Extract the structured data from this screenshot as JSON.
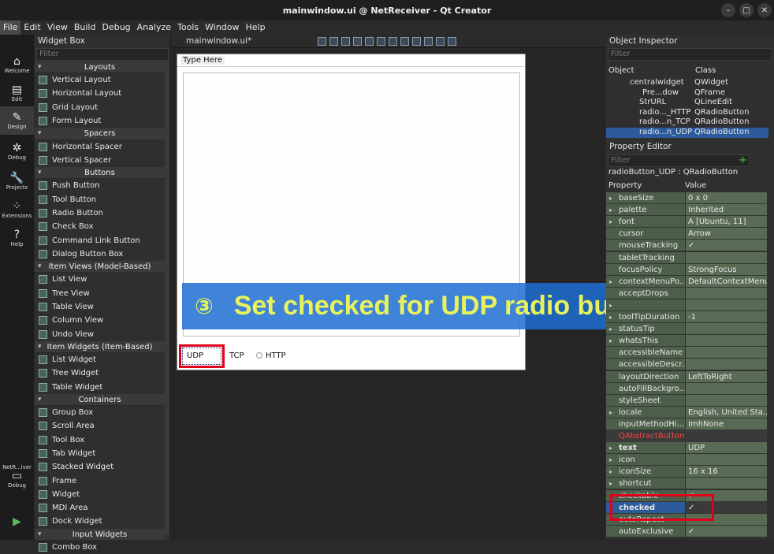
{
  "window": {
    "title": "mainwindow.ui @ NetReceiver - Qt Creator",
    "minimize": "–",
    "maximize": "□",
    "close": "✕"
  },
  "menu": [
    "File",
    "Edit",
    "View",
    "Build",
    "Debug",
    "Analyze",
    "Tools",
    "Window",
    "Help"
  ],
  "modes": [
    {
      "label": "Welcome",
      "icon": "⌂"
    },
    {
      "label": "Edit",
      "icon": "▤"
    },
    {
      "label": "Design",
      "icon": "✎"
    },
    {
      "label": "Debug",
      "icon": "✲"
    },
    {
      "label": "Projects",
      "icon": "🔧"
    },
    {
      "label": "Extensions",
      "icon": "⁘"
    },
    {
      "label": "Help",
      "icon": "?"
    }
  ],
  "kit": {
    "label": "NetR...iver",
    "sub": "Debug",
    "run": "▶"
  },
  "widget_box": {
    "title": "Widget Box",
    "filter_placeholder": "Filter",
    "groups": [
      {
        "name": "Layouts",
        "items": [
          "Vertical Layout",
          "Horizontal Layout",
          "Grid Layout",
          "Form Layout"
        ]
      },
      {
        "name": "Spacers",
        "items": [
          "Horizontal Spacer",
          "Vertical Spacer"
        ]
      },
      {
        "name": "Buttons",
        "items": [
          "Push Button",
          "Tool Button",
          "Radio Button",
          "Check Box",
          "Command Link Button",
          "Dialog Button Box"
        ]
      },
      {
        "name": "Item Views (Model-Based)",
        "items": [
          "List View",
          "Tree View",
          "Table View",
          "Column View",
          "Undo View"
        ]
      },
      {
        "name": "Item Widgets (Item-Based)",
        "items": [
          "List Widget",
          "Tree Widget",
          "Table Widget"
        ]
      },
      {
        "name": "Containers",
        "items": [
          "Group Box",
          "Scroll Area",
          "Tool Box",
          "Tab Widget",
          "Stacked Widget",
          "Frame",
          "Widget",
          "MDI Area",
          "Dock Widget"
        ]
      },
      {
        "name": "Input Widgets",
        "items": [
          "Combo Box"
        ]
      }
    ]
  },
  "editor": {
    "file": "mainwindow.ui*"
  },
  "form": {
    "type_here": "Type Here",
    "radios": [
      "UDP",
      "TCP",
      "HTTP"
    ]
  },
  "banner": {
    "number": "③",
    "text": "Set checked for UDP radio button."
  },
  "object_inspector": {
    "title": "Object Inspector",
    "filter_placeholder": "Filter",
    "col_object": "Object",
    "col_class": "Class",
    "rows": [
      {
        "object": "centralwidget",
        "class": "QWidget"
      },
      {
        "object": "Pre...dow",
        "class": "QFrame"
      },
      {
        "object": "StrURL",
        "class": "QLineEdit"
      },
      {
        "object": "radio..._HTTP",
        "class": "QRadioButton"
      },
      {
        "object": "radio...n_TCP",
        "class": "QRadioButton"
      },
      {
        "object": "radio...n_UDP",
        "class": "QRadioButton"
      }
    ]
  },
  "property_editor": {
    "title": "Property Editor",
    "filter_placeholder": "Filter",
    "context": "radioButton_UDP : QRadioButton",
    "col_property": "Property",
    "col_value": "Value",
    "rows": [
      {
        "p": "baseSize",
        "v": "0 x 0"
      },
      {
        "p": "palette",
        "v": "Inherited"
      },
      {
        "p": "font",
        "v": "A  [Ubuntu, 11]"
      },
      {
        "p": "cursor",
        "v": "Arrow"
      },
      {
        "p": "mouseTracking",
        "v": "✓"
      },
      {
        "p": "tabletTracking",
        "v": ""
      },
      {
        "p": "focusPolicy",
        "v": "StrongFocus"
      },
      {
        "p": "contextMenuPo...",
        "v": "DefaultContextMenu"
      },
      {
        "p": "acceptDrops",
        "v": ""
      },
      {
        "p": "",
        "v": ""
      },
      {
        "p": "toolTipDuration",
        "v": "-1"
      },
      {
        "p": "statusTip",
        "v": ""
      },
      {
        "p": "whatsThis",
        "v": ""
      },
      {
        "p": "accessibleName",
        "v": ""
      },
      {
        "p": "accessibleDescr...",
        "v": ""
      },
      {
        "p": "layoutDirection",
        "v": "LeftToRight"
      },
      {
        "p": "autoFillBackgro...",
        "v": ""
      },
      {
        "p": "styleSheet",
        "v": ""
      },
      {
        "p": "locale",
        "v": "English, United Sta..."
      },
      {
        "p": "inputMethodHi...",
        "v": "ImhNone"
      }
    ],
    "group": "QAbstractButton",
    "rows2": [
      {
        "p": "text",
        "v": "UDP"
      },
      {
        "p": "icon",
        "v": ""
      },
      {
        "p": "iconSize",
        "v": "16 x 16"
      },
      {
        "p": "shortcut",
        "v": ""
      },
      {
        "p": "checkable",
        "v": "✓"
      },
      {
        "p": "checked",
        "v": "✓"
      },
      {
        "p": "autoRepeat",
        "v": ""
      },
      {
        "p": "autoExclusive",
        "v": "✓"
      }
    ]
  }
}
